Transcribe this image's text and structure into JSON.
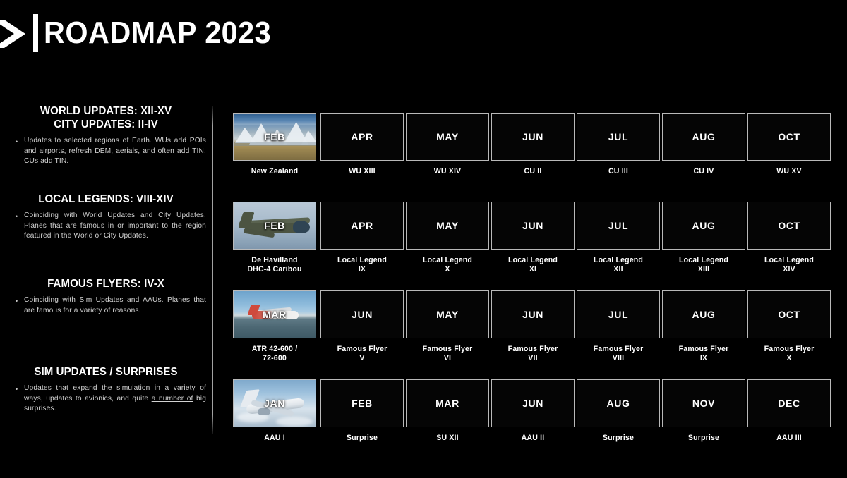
{
  "header": {
    "title": "ROADMAP 2023",
    "logo_icon": "chevron-right-icon",
    "divider_icon": "vertical-bar-divider"
  },
  "colors": {
    "background": "#000000",
    "text": "#ffffff",
    "body_text": "#d2d2d2",
    "cell_border": "#b9b9b9",
    "divider": "#bebebe"
  },
  "sidebar": {
    "sections": [
      {
        "heading_lines": [
          "WORLD UPDATES: XII-XV",
          "CITY UPDATES: II-IV"
        ],
        "bullet": "•",
        "text": "Updates to selected regions of Earth. WUs add POIs and airports, refresh DEM, aerials, and often add TIN. CUs add TIN."
      },
      {
        "heading_lines": [
          "LOCAL LEGENDS: VIII-XIV"
        ],
        "bullet": "•",
        "text": "Coinciding with World Updates and City Updates. Planes that are famous in or important to the region featured in the World or City Updates."
      },
      {
        "heading_lines": [
          "FAMOUS FLYERS: IV-X"
        ],
        "bullet": "•",
        "text": "Coinciding with Sim Updates and AAUs. Planes that are famous for a variety of reasons."
      },
      {
        "heading_lines": [
          "SIM UPDATES / SURPRISES"
        ],
        "bullet": "•",
        "text_before": "Updates that expand the simulation in a variety of ways, updates to avionics, and quite ",
        "text_underlined": "a number of",
        "text_after": " big surprises."
      }
    ]
  },
  "roadmap": {
    "rows": [
      {
        "name": "world-and-city-updates-row",
        "cells": [
          {
            "month": "FEB",
            "caption": "New Zealand",
            "thumbnail": "new-zealand-mountains-photo"
          },
          {
            "month": "APR",
            "caption": "WU XIII",
            "thumbnail": null
          },
          {
            "month": "MAY",
            "caption": "WU XIV",
            "thumbnail": null
          },
          {
            "month": "JUN",
            "caption": "CU II",
            "thumbnail": null
          },
          {
            "month": "JUL",
            "caption": "CU III",
            "thumbnail": null
          },
          {
            "month": "AUG",
            "caption": "CU IV",
            "thumbnail": null
          },
          {
            "month": "OCT",
            "caption": "WU XV",
            "thumbnail": null
          }
        ]
      },
      {
        "name": "local-legends-row",
        "cells": [
          {
            "month": "FEB",
            "caption": "De Havilland\nDHC-4 Caribou",
            "thumbnail": "de-havilland-caribou-photo"
          },
          {
            "month": "APR",
            "caption": "Local Legend\nIX",
            "thumbnail": null
          },
          {
            "month": "MAY",
            "caption": "Local Legend\nX",
            "thumbnail": null
          },
          {
            "month": "JUN",
            "caption": "Local Legend\nXI",
            "thumbnail": null
          },
          {
            "month": "JUL",
            "caption": "Local Legend\nXII",
            "thumbnail": null
          },
          {
            "month": "AUG",
            "caption": "Local Legend\nXIII",
            "thumbnail": null
          },
          {
            "month": "OCT",
            "caption": "Local Legend\nXIV",
            "thumbnail": null
          }
        ]
      },
      {
        "name": "famous-flyers-row",
        "cells": [
          {
            "month": "MAR",
            "caption": "ATR 42-600 /\n72-600",
            "thumbnail": "atr-aircraft-photo"
          },
          {
            "month": "JUN",
            "caption": "Famous Flyer\nV",
            "thumbnail": null
          },
          {
            "month": "MAY",
            "caption": "Famous Flyer\nVI",
            "thumbnail": null
          },
          {
            "month": "JUN",
            "caption": "Famous Flyer\nVII",
            "thumbnail": null
          },
          {
            "month": "JUL",
            "caption": "Famous Flyer\nVIII",
            "thumbnail": null
          },
          {
            "month": "AUG",
            "caption": "Famous Flyer\nIX",
            "thumbnail": null
          },
          {
            "month": "OCT",
            "caption": "Famous Flyer\nX",
            "thumbnail": null
          }
        ]
      },
      {
        "name": "sim-updates-surprises-row",
        "cells": [
          {
            "month": "JAN",
            "caption": "AAU I",
            "thumbnail": "aau-jet-photo"
          },
          {
            "month": "FEB",
            "caption": "Surprise",
            "thumbnail": null
          },
          {
            "month": "MAR",
            "caption": "SU XII",
            "thumbnail": null
          },
          {
            "month": "JUN",
            "caption": "AAU II",
            "thumbnail": null
          },
          {
            "month": "AUG",
            "caption": "Surprise",
            "thumbnail": null
          },
          {
            "month": "NOV",
            "caption": "Surprise",
            "thumbnail": null
          },
          {
            "month": "DEC",
            "caption": "AAU III",
            "thumbnail": null
          }
        ]
      }
    ]
  }
}
